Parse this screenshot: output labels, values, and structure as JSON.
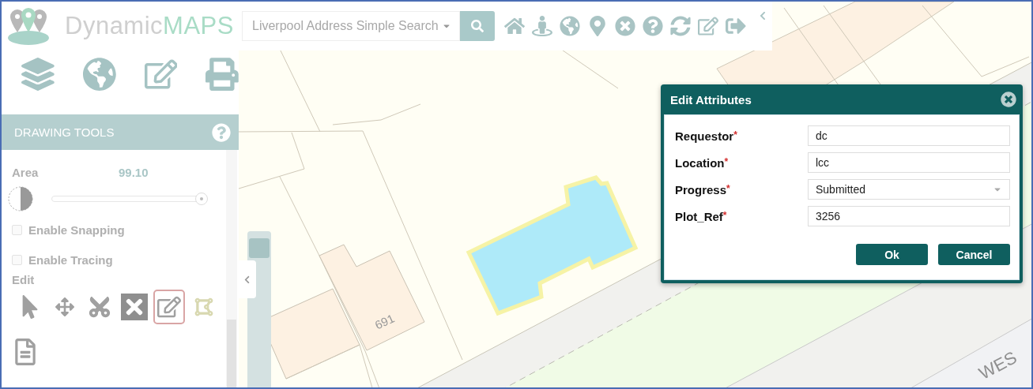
{
  "logo": {
    "parts": [
      "Dynamic",
      "MAPS"
    ]
  },
  "search": {
    "value": "Liverpool Address Simple Search"
  },
  "sidebar": {
    "panel_title": "DRAWING TOOLS",
    "measurements": [
      {
        "label": "Area",
        "value": "99.10"
      }
    ],
    "opacity": {
      "level": 1.0
    },
    "options": [
      {
        "label": "Enable Snapping",
        "checked": false
      },
      {
        "label": "Enable Tracing",
        "checked": false
      }
    ],
    "edit_label": "Edit",
    "edit_tools": [
      {
        "kind": "pointer",
        "selected": false
      },
      {
        "kind": "move",
        "selected": false
      },
      {
        "kind": "cut",
        "selected": false
      },
      {
        "kind": "delete",
        "selected": false
      },
      {
        "kind": "attributes",
        "selected": true
      },
      {
        "kind": "vertices",
        "selected": false
      }
    ]
  },
  "map": {
    "zoom": {
      "level": 0.95
    },
    "labels": [
      {
        "kind": "house",
        "text": "691"
      },
      {
        "kind": "street",
        "text": "WES"
      }
    ]
  },
  "dialog": {
    "title": "Edit Attributes",
    "fields": [
      {
        "label": "Requestor",
        "required_mark": "*",
        "kind": "text",
        "value": "dc"
      },
      {
        "label": "Location",
        "required_mark": "*",
        "kind": "text",
        "value": "lcc"
      },
      {
        "label": "Progress",
        "required_mark": "*",
        "kind": "select",
        "value": "Submitted"
      },
      {
        "label": "Plot_Ref",
        "required_mark": "*",
        "kind": "text",
        "value": "3256"
      }
    ],
    "buttons": [
      "Ok",
      "Cancel"
    ]
  }
}
